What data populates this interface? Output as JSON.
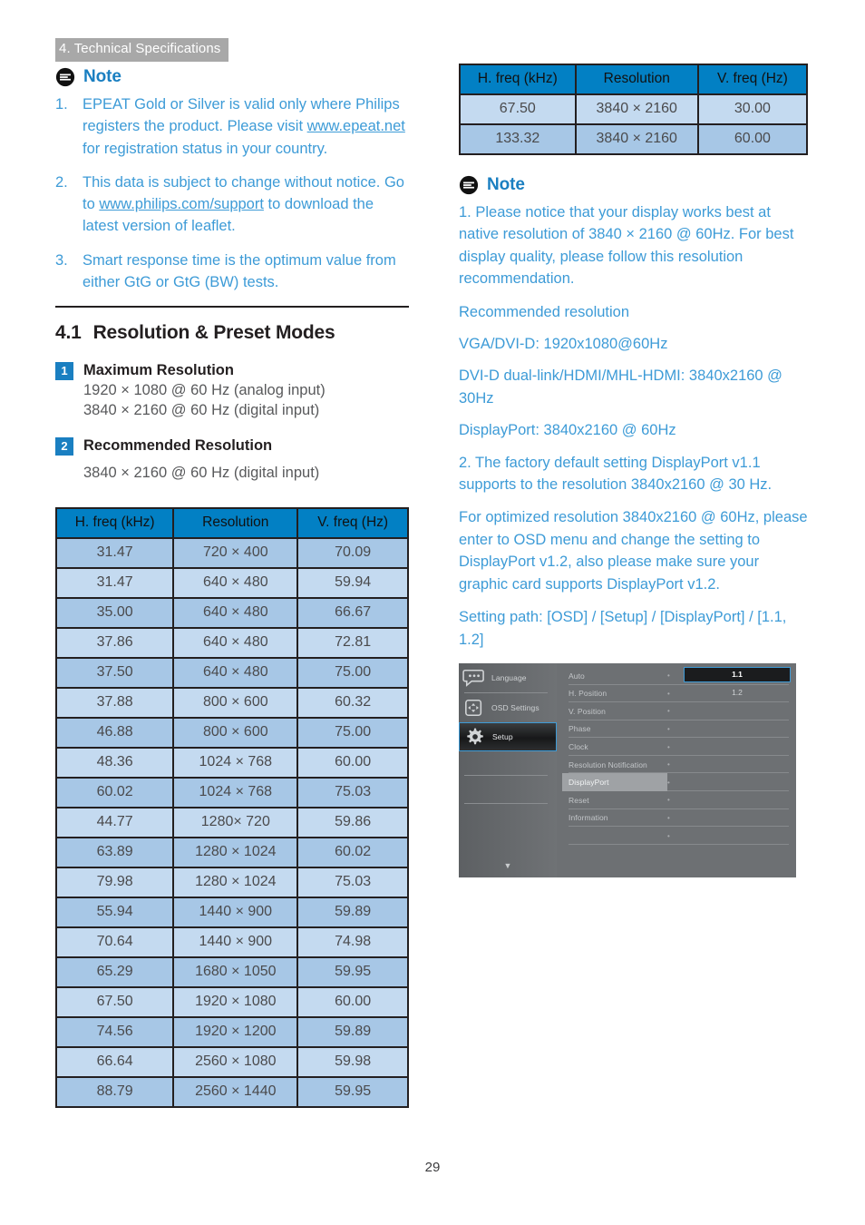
{
  "chapter_tab": "4. Technical Specifications",
  "page_number": "29",
  "left": {
    "note": {
      "title": "Note",
      "items": [
        {
          "num": "1.",
          "parts": [
            {
              "t": "EPEAT Gold or Silver is valid only where Philips registers the product. Please visit ",
              "link": false
            },
            {
              "t": "www.epeat.net",
              "link": true
            },
            {
              "t": " for registration status in your country.",
              "link": false
            }
          ]
        },
        {
          "num": "2.",
          "parts": [
            {
              "t": "This data is subject to change without notice. Go to ",
              "link": false
            },
            {
              "t": "www.philips.com/support",
              "link": true
            },
            {
              "t": " to download the latest version of leaflet.",
              "link": false
            }
          ]
        },
        {
          "num": "3.",
          "parts": [
            {
              "t": "Smart response time is the optimum value from either GtG or GtG (BW) tests.",
              "link": false
            }
          ]
        }
      ]
    },
    "section": {
      "number": "4.1",
      "title": "Resolution & Preset Modes"
    },
    "blocks": [
      {
        "badge": "1",
        "title": "Maximum Resolution",
        "lines": [
          "1920 × 1080 @ 60 Hz (analog input)",
          "3840 × 2160 @ 60 Hz (digital input)"
        ]
      },
      {
        "badge": "2",
        "title": "Recommended Resolution",
        "lines": [
          "3840 × 2160 @ 60 Hz (digital input)"
        ]
      }
    ],
    "table": {
      "headers": [
        "H. freq (kHz)",
        "Resolution",
        "V. freq (Hz)"
      ],
      "rows": [
        [
          "31.47",
          "720 × 400",
          "70.09"
        ],
        [
          "31.47",
          "640 × 480",
          "59.94"
        ],
        [
          "35.00",
          "640 × 480",
          "66.67"
        ],
        [
          "37.86",
          "640 × 480",
          "72.81"
        ],
        [
          "37.50",
          "640 × 480",
          "75.00"
        ],
        [
          "37.88",
          "800 × 600",
          "60.32"
        ],
        [
          "46.88",
          "800 × 600",
          "75.00"
        ],
        [
          "48.36",
          "1024 × 768",
          "60.00"
        ],
        [
          "60.02",
          "1024 × 768",
          "75.03"
        ],
        [
          "44.77",
          "1280× 720",
          "59.86"
        ],
        [
          "63.89",
          "1280 × 1024",
          "60.02"
        ],
        [
          "79.98",
          "1280 × 1024",
          "75.03"
        ],
        [
          "55.94",
          "1440 × 900",
          "59.89"
        ],
        [
          "70.64",
          "1440 × 900",
          "74.98"
        ],
        [
          "65.29",
          "1680 × 1050",
          "59.95"
        ],
        [
          "67.50",
          "1920 × 1080",
          "60.00"
        ],
        [
          "74.56",
          "1920 × 1200",
          "59.89"
        ],
        [
          "66.64",
          "2560 × 1080",
          "59.98"
        ],
        [
          "88.79",
          "2560 × 1440",
          "59.95"
        ]
      ]
    }
  },
  "right": {
    "table": {
      "headers": [
        "H. freq (kHz)",
        "Resolution",
        "V. freq (Hz)"
      ],
      "rows": [
        [
          "67.50",
          "3840 × 2160",
          "30.00"
        ],
        [
          "133.32",
          "3840 × 2160",
          "60.00"
        ]
      ]
    },
    "note": {
      "title": "Note",
      "paragraphs": [
        "1.   Please notice that your display works best at native resolution of 3840 × 2160 @ 60Hz. For best display quality, please follow this resolution recommendation.",
        "Recommended resolution",
        "VGA/DVI-D: 1920x1080@60Hz",
        "DVI-D dual-link/HDMI/MHL-HDMI: 3840x2160 @ 30Hz",
        "DisplayPort: 3840x2160 @ 60Hz",
        "2.   The factory default setting DisplayPort v1.1 supports to the resolution 3840x2160 @ 30 Hz.",
        "For optimized resolution 3840x2160 @ 60Hz, please enter to OSD menu and change the setting to DisplayPort v1.2, also please make sure your graphic card supports DisplayPort v1.2.",
        "Setting path: [OSD] / [Setup] / [DisplayPort] / [1.1, 1.2]"
      ]
    },
    "osd": {
      "sidebar": [
        {
          "label": "Language",
          "icon": "speech-bubble-icon",
          "active": false
        },
        {
          "label": "OSD Settings",
          "icon": "osd-pad-icon",
          "active": false
        },
        {
          "label": "Setup",
          "icon": "gear-icon",
          "active": true
        }
      ],
      "caret": "▼",
      "menu": [
        {
          "label": "Auto",
          "dot": "•",
          "highlighted": false
        },
        {
          "label": "H. Position",
          "dot": "•",
          "highlighted": false
        },
        {
          "label": "V. Position",
          "dot": "•",
          "highlighted": false
        },
        {
          "label": "Phase",
          "dot": "•",
          "highlighted": false
        },
        {
          "label": "Clock",
          "dot": "•",
          "highlighted": false
        },
        {
          "label": "Resolution Notification",
          "dot": "•",
          "highlighted": false
        },
        {
          "label": "DisplayPort",
          "dot": "•",
          "highlighted": true
        },
        {
          "label": "Reset",
          "dot": "•",
          "highlighted": false
        },
        {
          "label": "Information",
          "dot": "•",
          "highlighted": false
        },
        {
          "label": "",
          "dot": "•",
          "highlighted": false
        }
      ],
      "value_selected": "1.1",
      "value_second": "1.2"
    }
  },
  "colors": {
    "accent_blue": "#3d9bd7",
    "header_blue": "#0280c4",
    "row_dark": "#a7c7e6",
    "row_light": "#c4daf0",
    "tab_grey": "#a8a8a8",
    "osd_highlight_border": "#3d9bd7"
  }
}
